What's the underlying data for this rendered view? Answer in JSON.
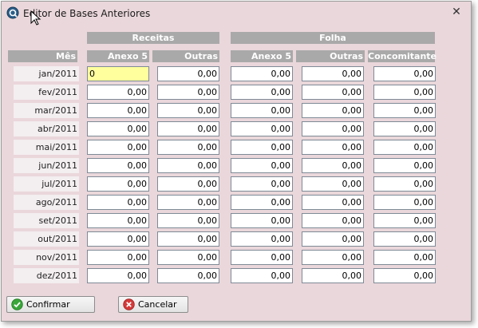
{
  "window": {
    "title": "Editor de Bases Anteriores"
  },
  "groups": {
    "receitas": "Receitas",
    "folha": "Folha"
  },
  "columns": {
    "mes": "Mês",
    "anexo5_receitas": "Anexo 5",
    "outras_receitas": "Outras",
    "anexo5_folha": "Anexo 5",
    "outras_folha": "Outras",
    "concomitante": "Concomitante"
  },
  "rows": [
    {
      "month": "jan/2011",
      "values": [
        "0",
        "0,00",
        "0,00",
        "0,00",
        "0,00"
      ]
    },
    {
      "month": "fev/2011",
      "values": [
        "0,00",
        "0,00",
        "0,00",
        "0,00",
        "0,00"
      ]
    },
    {
      "month": "mar/2011",
      "values": [
        "0,00",
        "0,00",
        "0,00",
        "0,00",
        "0,00"
      ]
    },
    {
      "month": "abr/2011",
      "values": [
        "0,00",
        "0,00",
        "0,00",
        "0,00",
        "0,00"
      ]
    },
    {
      "month": "mai/2011",
      "values": [
        "0,00",
        "0,00",
        "0,00",
        "0,00",
        "0,00"
      ]
    },
    {
      "month": "jun/2011",
      "values": [
        "0,00",
        "0,00",
        "0,00",
        "0,00",
        "0,00"
      ]
    },
    {
      "month": "jul/2011",
      "values": [
        "0,00",
        "0,00",
        "0,00",
        "0,00",
        "0,00"
      ]
    },
    {
      "month": "ago/2011",
      "values": [
        "0,00",
        "0,00",
        "0,00",
        "0,00",
        "0,00"
      ]
    },
    {
      "month": "set/2011",
      "values": [
        "0,00",
        "0,00",
        "0,00",
        "0,00",
        "0,00"
      ]
    },
    {
      "month": "out/2011",
      "values": [
        "0,00",
        "0,00",
        "0,00",
        "0,00",
        "0,00"
      ]
    },
    {
      "month": "nov/2011",
      "values": [
        "0,00",
        "0,00",
        "0,00",
        "0,00",
        "0,00"
      ]
    },
    {
      "month": "dez/2011",
      "values": [
        "0,00",
        "0,00",
        "0,00",
        "0,00",
        "0,00"
      ]
    }
  ],
  "buttons": {
    "confirm": "Confirmar",
    "cancel": "Cancelar"
  },
  "icons": {
    "app": "app-icon",
    "close": "close-icon",
    "confirm": "check-circle-icon",
    "cancel": "x-circle-icon"
  },
  "colors": {
    "window_bg": "#ead7db",
    "header_bg": "#a9a9a9",
    "focused_cell": "#ffff9e",
    "confirm_icon": "#3aa63a",
    "cancel_icon": "#d53a3a"
  }
}
